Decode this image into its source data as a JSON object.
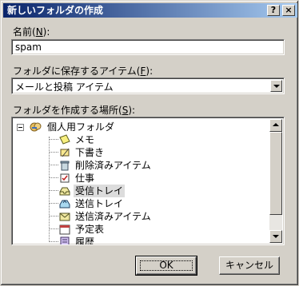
{
  "window": {
    "title": "新しいフォルダの作成",
    "help_label": "?",
    "close_label": "×"
  },
  "name_field": {
    "label": "名前(",
    "accel": "N",
    "label_end": "):",
    "value": "spam"
  },
  "folder_type": {
    "label": "フォルダに保存するアイテム(",
    "accel": "F",
    "label_end": "):",
    "value": "メールと投稿 アイテム"
  },
  "location": {
    "label": "フォルダを作成する場所(",
    "accel": "S",
    "label_end": "):",
    "root": {
      "label": "個人用フォルダ",
      "icon": "personal-folders-icon"
    },
    "items": [
      {
        "label": "メモ",
        "icon": "notes-icon",
        "selected": false
      },
      {
        "label": "下書き",
        "icon": "drafts-icon",
        "selected": false
      },
      {
        "label": "削除済みアイテム",
        "icon": "deleted-items-icon",
        "selected": false
      },
      {
        "label": "仕事",
        "icon": "tasks-icon",
        "selected": false
      },
      {
        "label": "受信トレイ",
        "icon": "inbox-icon",
        "selected": true
      },
      {
        "label": "送信トレイ",
        "icon": "outbox-icon",
        "selected": false
      },
      {
        "label": "送信済みアイテム",
        "icon": "sent-items-icon",
        "selected": false
      },
      {
        "label": "予定表",
        "icon": "calendar-icon",
        "selected": false
      },
      {
        "label": "履歴",
        "icon": "journal-icon",
        "selected": false
      }
    ]
  },
  "buttons": {
    "ok": "OK",
    "cancel": "キャンセル"
  }
}
